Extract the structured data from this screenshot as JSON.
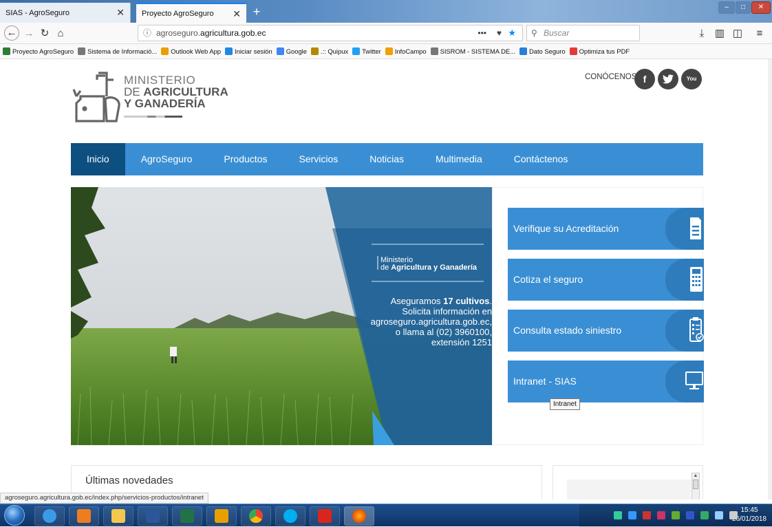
{
  "browser": {
    "tabs": [
      {
        "label": "SIAS - AgroSeguro"
      },
      {
        "label": "Proyecto AgroSeguro"
      }
    ],
    "url_prefix": "agroseguro.",
    "url_domain": "agricultura.gob.ec",
    "search_placeholder": "Buscar",
    "bookmarks": [
      {
        "label": "Proyecto AgroSeguro",
        "color": "#2e7d32"
      },
      {
        "label": "Sistema de Informació...",
        "color": "#777777"
      },
      {
        "label": "Outlook Web App",
        "color": "#e8a000"
      },
      {
        "label": "Iniciar sesión",
        "color": "#1e88e5"
      },
      {
        "label": "Google",
        "color": "#4285f4"
      },
      {
        "label": ".:: Quipux",
        "color": "#b08a00"
      },
      {
        "label": "Twitter",
        "color": "#1da1f2"
      },
      {
        "label": "InfoCampo",
        "color": "#f0a000"
      },
      {
        "label": "SISROM - SISTEMA DE...",
        "color": "#777777"
      },
      {
        "label": "Dato Seguro",
        "color": "#2a7fd4"
      },
      {
        "label": "Optimiza tus PDF",
        "color": "#e53935"
      }
    ],
    "status_url": "agroseguro.agricultura.gob.ec/index.php/servicios-productos/intranet"
  },
  "header": {
    "logo_line1": "MINISTERIO",
    "logo_line2_prefix": "DE ",
    "logo_line2_bold": "AGRICULTURA",
    "logo_line3": "Y GANADERÍA",
    "conocenos": "CONÓCENOS",
    "social": [
      "f",
      "t",
      "You"
    ]
  },
  "nav": {
    "items": [
      "Inicio",
      "AgroSeguro",
      "Productos",
      "Servicios",
      "Noticias",
      "Multimedia",
      "Contáctenos"
    ],
    "active": "Inicio"
  },
  "hero": {
    "ministry_small": "Ministerio",
    "ministry_bold_prefix": "de ",
    "ministry_bold": "Agricultura y Ganadería",
    "line1_prefix": "Aseguramos ",
    "line1_bold": "17 cultivos",
    "line1_suffix": ".",
    "line2": "Solicita información en",
    "line3": "agroseguro.agricultura.gob.ec,",
    "line4": "o llama al (02) 3960100,",
    "line5": "extensión 1251"
  },
  "cards": [
    {
      "label": "Verifique su Acreditación",
      "icon": "document-icon"
    },
    {
      "label": "Cotiza el seguro",
      "icon": "calculator-icon"
    },
    {
      "label": "Consulta estado siniestro",
      "icon": "clipboard-check-icon"
    },
    {
      "label": "Intranet - SIAS",
      "icon": "monitor-icon"
    }
  ],
  "tooltip": "Intranet",
  "news": {
    "title": "Últimas novedades"
  },
  "taskbar": {
    "time": "15:45",
    "date": "26/01/2018"
  }
}
